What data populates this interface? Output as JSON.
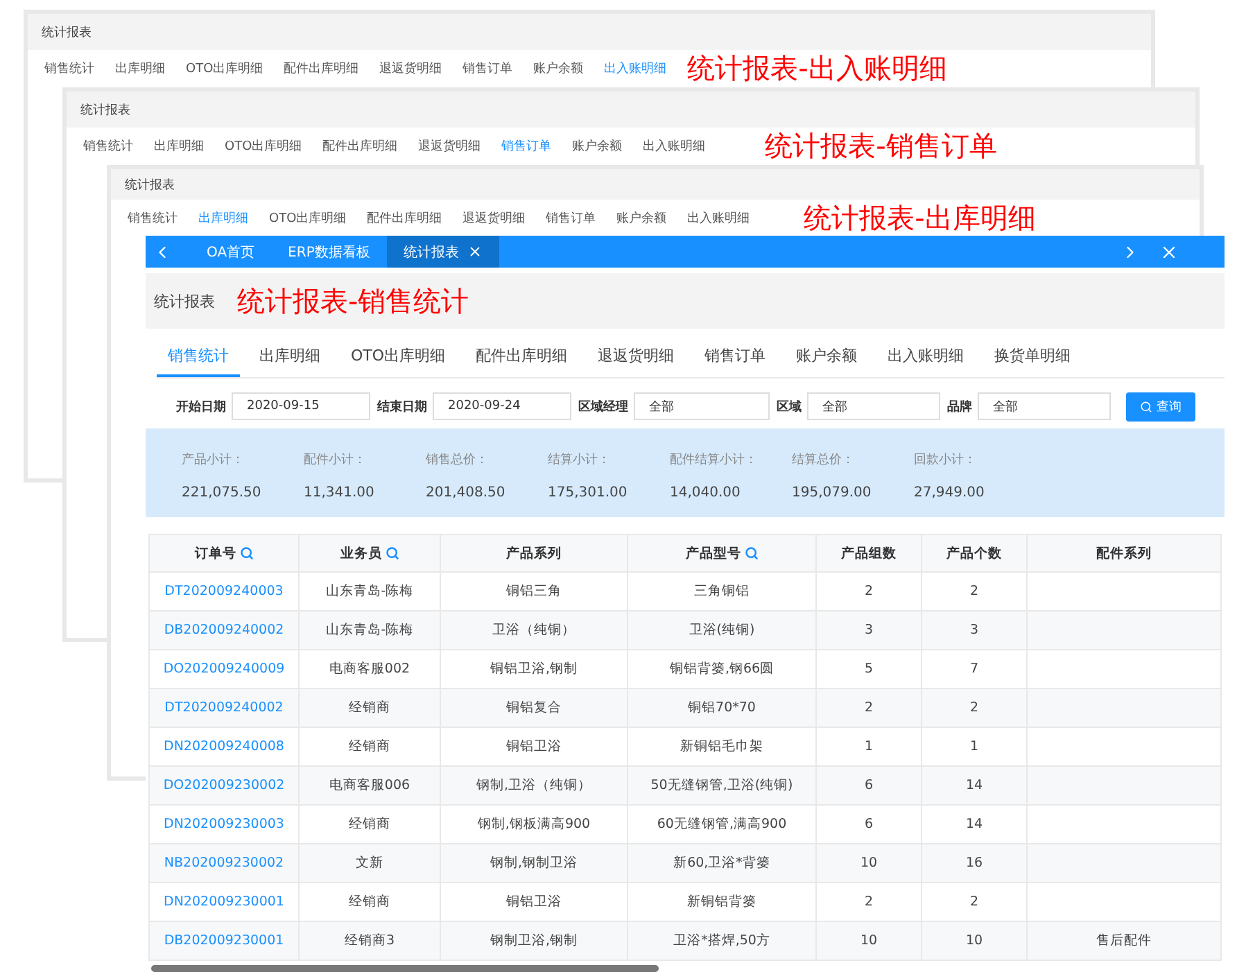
{
  "windows": [
    {
      "title": "统计报表",
      "caption": "统计报表-出入账明细",
      "tabs": [
        {
          "label": "销售统计",
          "selected": false
        },
        {
          "label": "出库明细",
          "selected": false
        },
        {
          "label": "OTO出库明细",
          "selected": false
        },
        {
          "label": "配件出库明细",
          "selected": false
        },
        {
          "label": "退返货明细",
          "selected": false
        },
        {
          "label": "销售订单",
          "selected": false
        },
        {
          "label": "账户余额",
          "selected": false
        },
        {
          "label": "出入账明细",
          "selected": true
        }
      ]
    },
    {
      "title": "统计报表",
      "caption": "统计报表-销售订单",
      "tabs": [
        {
          "label": "销售统计",
          "selected": false
        },
        {
          "label": "出库明细",
          "selected": false
        },
        {
          "label": "OTO出库明细",
          "selected": false
        },
        {
          "label": "配件出库明细",
          "selected": false
        },
        {
          "label": "退返货明细",
          "selected": false
        },
        {
          "label": "销售订单",
          "selected": true
        },
        {
          "label": "账户余额",
          "selected": false
        },
        {
          "label": "出入账明细",
          "selected": false
        }
      ]
    },
    {
      "title": "统计报表",
      "caption": "统计报表-出库明细",
      "tabs": [
        {
          "label": "销售统计",
          "selected": false
        },
        {
          "label": "出库明细",
          "selected": true
        },
        {
          "label": "OTO出库明细",
          "selected": false
        },
        {
          "label": "配件出库明细",
          "selected": false
        },
        {
          "label": "退返货明细",
          "selected": false
        },
        {
          "label": "销售订单",
          "selected": false
        },
        {
          "label": "账户余额",
          "selected": false
        },
        {
          "label": "出入账明细",
          "selected": false
        }
      ]
    }
  ],
  "main": {
    "nav_tabs": [
      {
        "label": "OA首页",
        "selected": false,
        "closable": false
      },
      {
        "label": "ERP数据看板",
        "selected": false,
        "closable": false
      },
      {
        "label": "统计报表",
        "selected": true,
        "closable": true
      }
    ],
    "title": "统计报表",
    "caption": "统计报表-销售统计",
    "tabs": [
      {
        "label": "销售统计",
        "selected": true
      },
      {
        "label": "出库明细",
        "selected": false
      },
      {
        "label": "OTO出库明细",
        "selected": false
      },
      {
        "label": "配件出库明细",
        "selected": false
      },
      {
        "label": "退返货明细",
        "selected": false
      },
      {
        "label": "销售订单",
        "selected": false
      },
      {
        "label": "账户余额",
        "selected": false
      },
      {
        "label": "出入账明细",
        "selected": false
      },
      {
        "label": "换货单明细",
        "selected": false
      }
    ],
    "filters": [
      {
        "label": "开始日期",
        "value": "2020-09-15"
      },
      {
        "label": "结束日期",
        "value": "2020-09-24"
      },
      {
        "label": "区域经理",
        "value": "全部"
      },
      {
        "label": "区域",
        "value": "全部"
      },
      {
        "label": "品牌",
        "value": "全部"
      }
    ],
    "search_button": "查询",
    "summary": [
      {
        "label": "产品小计：",
        "value": "221,075.50"
      },
      {
        "label": "配件小计：",
        "value": "11,341.00"
      },
      {
        "label": "销售总价：",
        "value": "201,408.50"
      },
      {
        "label": "结算小计：",
        "value": "175,301.00"
      },
      {
        "label": "配件结算小计：",
        "value": "14,040.00"
      },
      {
        "label": "结算总价：",
        "value": "195,079.00"
      },
      {
        "label": "回款小计：",
        "value": "27,949.00"
      }
    ],
    "table": {
      "columns": [
        {
          "label": "订单号",
          "searchable": true
        },
        {
          "label": "业务员",
          "searchable": true
        },
        {
          "label": "产品系列",
          "searchable": false
        },
        {
          "label": "产品型号",
          "searchable": true
        },
        {
          "label": "产品组数",
          "searchable": false
        },
        {
          "label": "产品个数",
          "searchable": false
        },
        {
          "label": "配件系列",
          "searchable": false
        }
      ],
      "rows": [
        [
          "DT202009240003",
          "山东青岛-陈梅",
          "铜铝三角",
          "三角铜铝",
          "2",
          "2",
          ""
        ],
        [
          "DB202009240002",
          "山东青岛-陈梅",
          "卫浴（纯铜）",
          "卫浴(纯铜)",
          "3",
          "3",
          ""
        ],
        [
          "DO202009240009",
          "电商客服002",
          "铜铝卫浴,钢制",
          "铜铝背篓,钢66圆",
          "5",
          "7",
          ""
        ],
        [
          "DT202009240002",
          "经销商",
          "铜铝复合",
          "铜铝70*70",
          "2",
          "2",
          ""
        ],
        [
          "DN202009240008",
          "经销商",
          "铜铝卫浴",
          "新铜铝毛巾架",
          "1",
          "1",
          ""
        ],
        [
          "DO202009230002",
          "电商客服006",
          "钢制,卫浴（纯铜）",
          "50无缝钢管,卫浴(纯铜)",
          "6",
          "14",
          ""
        ],
        [
          "DN202009230003",
          "经销商",
          "钢制,钢板满高900",
          "60无缝钢管,满高900",
          "6",
          "14",
          ""
        ],
        [
          "NB202009230002",
          "文新",
          "钢制,钢制卫浴",
          "新60,卫浴*背篓",
          "10",
          "16",
          ""
        ],
        [
          "DN202009230001",
          "经销商",
          "铜铝卫浴",
          "新铜铝背篓",
          "2",
          "2",
          ""
        ],
        [
          "DB202009230001",
          "经销商3",
          "钢制卫浴,钢制",
          "卫浴*搭焊,50方",
          "10",
          "10",
          "售后配件"
        ]
      ]
    }
  }
}
